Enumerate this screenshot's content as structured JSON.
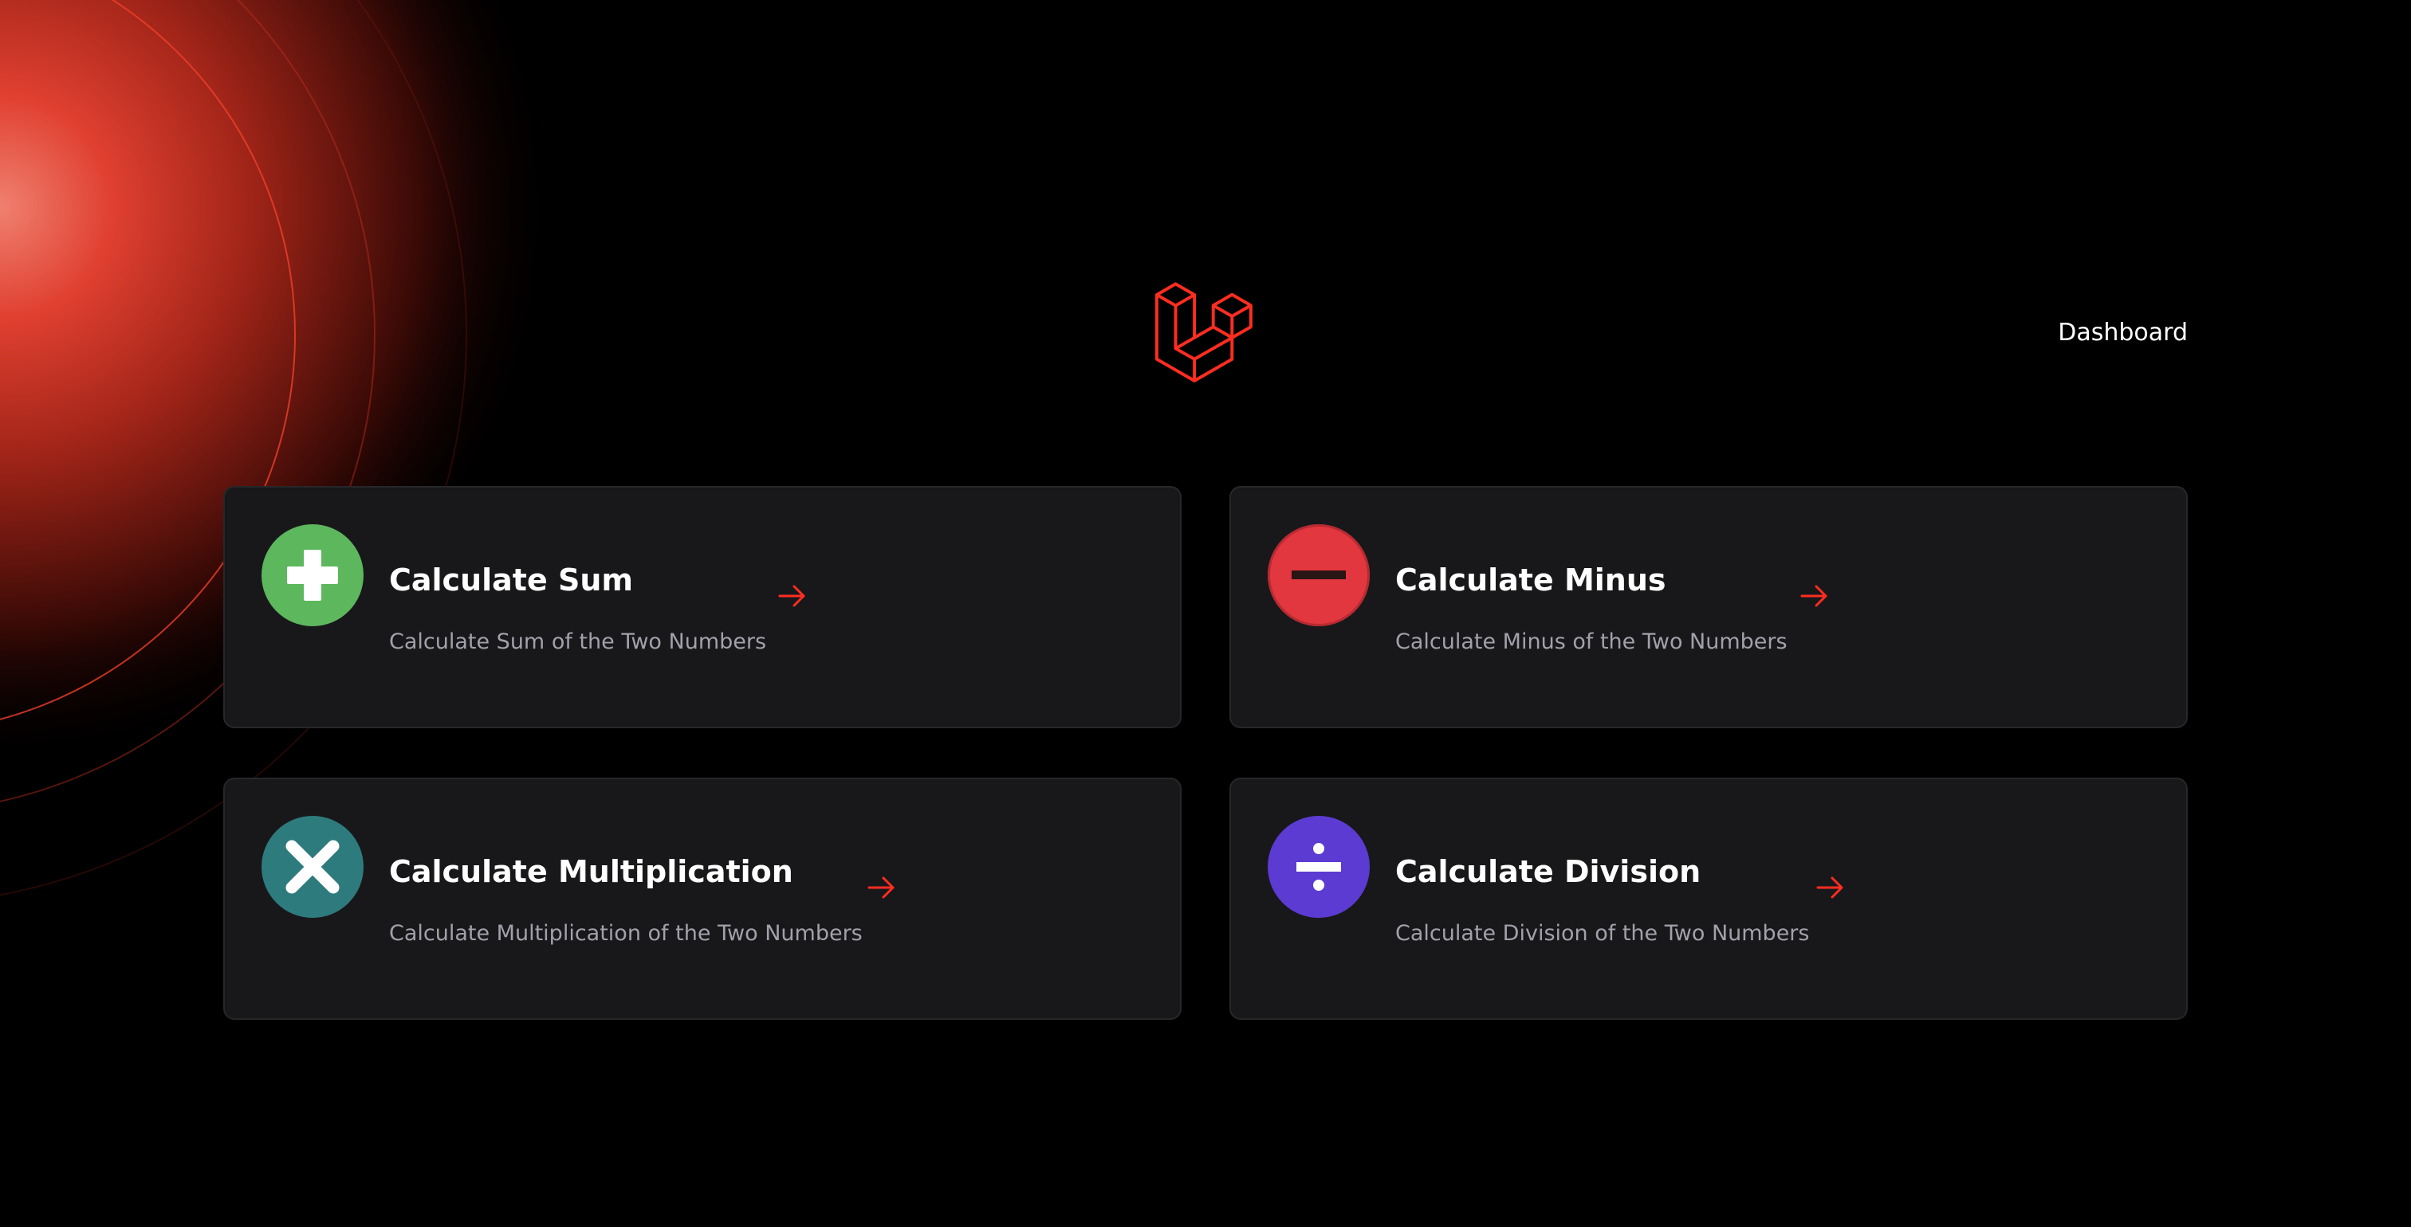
{
  "header": {
    "logo_icon": "laravel-logo-icon",
    "nav_link": "Dashboard"
  },
  "colors": {
    "accent": "#FF2D20",
    "card_background": "#18181B",
    "sum": "#5DB75D",
    "minus": "#E2373F",
    "multiply": "#2E7B7D",
    "divide": "#5B3BD1"
  },
  "cards": [
    {
      "title": "Calculate Sum",
      "description": "Calculate Sum of the Two Numbers",
      "icon": "plus-icon",
      "arrow_icon": "arrow-right-icon"
    },
    {
      "title": "Calculate Minus",
      "description": "Calculate Minus of the Two Numbers",
      "icon": "minus-icon",
      "arrow_icon": "arrow-right-icon"
    },
    {
      "title": "Calculate Multiplication",
      "description": "Calculate Multiplication of the Two Numbers",
      "icon": "multiply-icon",
      "arrow_icon": "arrow-right-icon"
    },
    {
      "title": "Calculate Division",
      "description": "Calculate Division of the Two Numbers",
      "icon": "divide-icon",
      "arrow_icon": "arrow-right-icon"
    }
  ]
}
